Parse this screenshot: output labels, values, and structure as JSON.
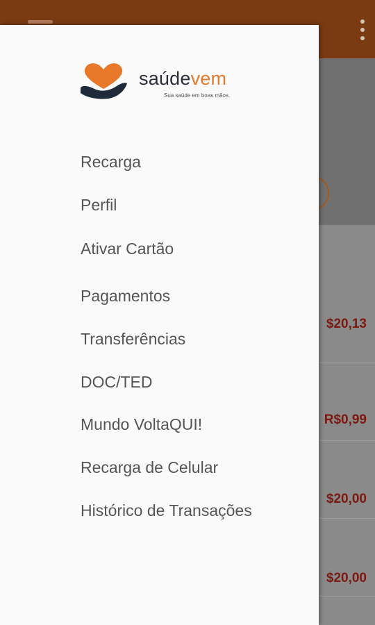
{
  "background": {
    "amounts": [
      "$20,13",
      "R$0,99",
      "$20,00",
      "$20,00"
    ]
  },
  "drawer": {
    "logo": {
      "brand_main": "saúde",
      "brand_accent": "vem",
      "tagline": "Sua saúde em boas mãos.",
      "colors": {
        "heart": "#e8782a",
        "hand": "#1f2a3a"
      }
    },
    "menu": [
      "Recarga",
      "Perfil",
      "Ativar Cartão",
      "Pagamentos",
      "Transferências",
      "DOC/TED",
      "Mundo VoltaQUI!",
      "Recarga de Celular",
      "Histórico de Transações"
    ]
  },
  "colors": {
    "appbar": "#7a3a12",
    "accent": "#e8782a",
    "amount": "#7a1a12"
  }
}
